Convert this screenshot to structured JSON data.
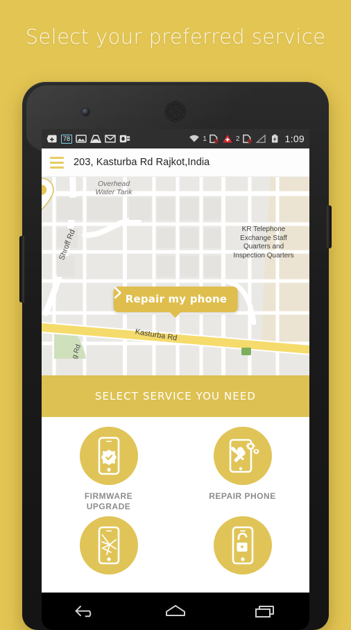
{
  "promo": {
    "title": "Select your preferred service"
  },
  "statusbar": {
    "left_icons": [
      {
        "name": "plus-badge-icon"
      },
      {
        "name": "count-badge-icon",
        "label": "78"
      },
      {
        "name": "photo-icon"
      },
      {
        "name": "inbox-icon"
      },
      {
        "name": "gmail-icon"
      },
      {
        "name": "outlook-icon"
      }
    ],
    "right_icons": [
      {
        "name": "wifi-icon"
      },
      {
        "name": "sim1-label",
        "label": "1"
      },
      {
        "name": "sim-no-signal-icon"
      },
      {
        "name": "medical-cross-icon"
      },
      {
        "name": "sim2-label",
        "label": "2"
      },
      {
        "name": "sim-no-signal-icon-2"
      },
      {
        "name": "signal-triangle-icon"
      },
      {
        "name": "battery-charging-icon"
      }
    ],
    "clock": "1:09"
  },
  "appbar": {
    "menu_icon": "hamburger-icon",
    "title": "203, Kasturba Rd Rajkot,India"
  },
  "map": {
    "labels": {
      "water_tank": "Overhead\nWater Tank",
      "water_tank_line1": "Overhead",
      "water_tank_line2": "Water Tank",
      "shroff_rd": "Shroff Rd",
      "kr_exchange": "KR Telephone Exchange Staff Quarters and Inspection Quarters",
      "kasturba_rd": "Kasturba Rd",
      "second_rd": "g Rd"
    },
    "callout": {
      "label": "Repair my phone",
      "chevron_icon": "chevron-right-icon"
    },
    "pin_icon": "map-pin-icon"
  },
  "service_banner": {
    "title": "SELECT SERVICE YOU NEED"
  },
  "services": [
    {
      "label_line1": "FIRMWARE",
      "label_line2": "UPGRADE",
      "icon": "phone-check-icon"
    },
    {
      "label_line1": "REPAIR PHONE",
      "label_line2": "",
      "icon": "phone-gear-tools-icon"
    },
    {
      "label_line1": "",
      "label_line2": "",
      "icon": "phone-cracked-screen-icon"
    },
    {
      "label_line1": "",
      "label_line2": "",
      "icon": "phone-unlock-icon"
    }
  ],
  "navbar": {
    "back": "back-icon",
    "home": "home-icon",
    "recents": "recents-icon"
  },
  "colors": {
    "brand_gold": "#e3c553",
    "banner_gold": "#ddc152",
    "callout_gold": "#dfbe4d",
    "circle_gold": "#e0c457",
    "label_gray": "#8c8c8c"
  }
}
